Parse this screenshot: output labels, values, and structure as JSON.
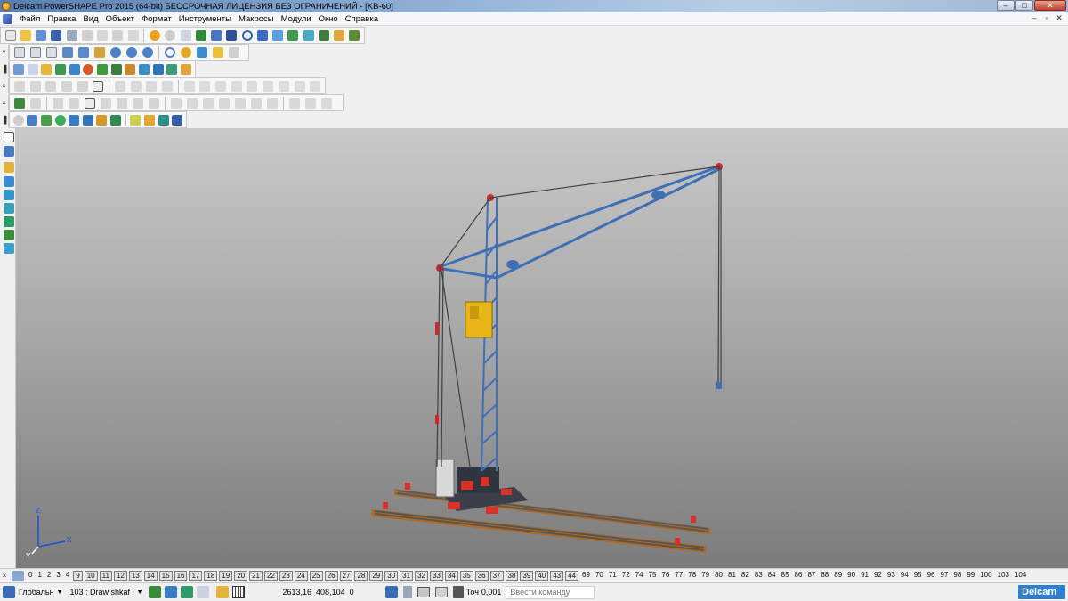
{
  "window": {
    "title": "Delcam PowerSHAPE Pro 2015 (64-bit) БЕССРОЧНАЯ ЛИЦЕНЗИЯ БЕЗ ОГРАНИЧЕНИЙ - [KB-60]",
    "minimize": "–",
    "maximize": "□",
    "close": "✕"
  },
  "menu": {
    "items": [
      "Файл",
      "Правка",
      "Вид",
      "Объект",
      "Формат",
      "Инструменты",
      "Макросы",
      "Модули",
      "Окно",
      "Справка"
    ],
    "mdi_minimize": "–",
    "mdi_restore": "▫",
    "mdi_close": "✕"
  },
  "levels": {
    "plain_before": [
      "0",
      "1",
      "2",
      "3",
      "4"
    ],
    "boxed": [
      "9",
      "10",
      "11",
      "12",
      "13",
      "14",
      "15",
      "16",
      "17",
      "18",
      "19",
      "20",
      "21",
      "22",
      "23",
      "24",
      "25",
      "26",
      "27",
      "28",
      "29",
      "30",
      "31",
      "32",
      "33",
      "34",
      "35",
      "36",
      "37",
      "38",
      "39",
      "40",
      "43",
      "44"
    ],
    "plain_after": [
      "69",
      "70",
      "71",
      "72",
      "74",
      "75",
      "76",
      "77",
      "78",
      "79",
      "80",
      "81",
      "82",
      "83",
      "84",
      "85",
      "86",
      "87",
      "88",
      "89",
      "90",
      "91",
      "92",
      "93",
      "94",
      "95",
      "96",
      "97",
      "98",
      "99",
      "100",
      "103",
      "104"
    ]
  },
  "statusbar": {
    "workplane": "Глобальн",
    "command": "103 : Draw shkaf ι",
    "coord_x": "2613,16",
    "coord_y": "408,104",
    "coord_z": "0",
    "tolerance_label": "Точ",
    "tolerance": "0,001",
    "command_placeholder": "Ввести команду",
    "logo": "Delcam"
  },
  "viewport": {
    "axis_labels": {
      "x": "X",
      "y": "Y",
      "z": "Z"
    },
    "colors": {
      "crane_steel": "#3f6fb5",
      "cab": "#e8b417",
      "pulley": "#cc2a2a",
      "rail_tie": "#c87a2a",
      "rail": "#555555"
    }
  }
}
